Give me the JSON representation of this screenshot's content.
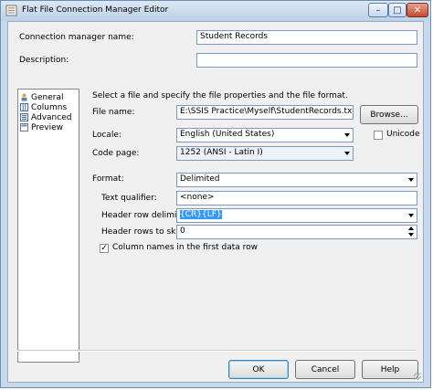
{
  "window": {
    "title": "Flat File Connection Manager Editor"
  },
  "fields": {
    "connection_name_label": "Connection manager name:",
    "connection_name_value": "Student Records",
    "description_label": "Description:",
    "description_value": ""
  },
  "nav": {
    "items": [
      {
        "label": "General",
        "selected": true
      },
      {
        "label": "Columns"
      },
      {
        "label": "Advanced"
      },
      {
        "label": "Preview"
      }
    ]
  },
  "general": {
    "instruction": "Select a file and specify the file properties and the file format.",
    "file_name_label": "File name:",
    "file_name_value": "E:\\SSIS Practice\\Myself\\StudentRecords.txt",
    "browse_label": "Browse...",
    "locale_label": "Locale:",
    "locale_value": "English (United States)",
    "unicode_label": "Unicode",
    "unicode_checked": false,
    "code_page_label": "Code page:",
    "code_page_value": "1252  (ANSI - Latin I)",
    "format_label": "Format:",
    "format_value": "Delimited",
    "text_qualifier_label": "Text qualifier:",
    "text_qualifier_value": "<none>",
    "header_row_delimiter_label": "Header row delimiter:",
    "header_row_delimiter_value": "{CR}{LF}",
    "header_rows_skip_label": "Header rows to skip:",
    "header_rows_skip_value": "0",
    "column_names_label": "Column names in the first data row",
    "column_names_checked": true
  },
  "buttons": {
    "ok": "OK",
    "cancel": "Cancel",
    "help": "Help"
  },
  "colors": {
    "selection": "#3399ff",
    "title_bar": "#c8d9ea",
    "close_button": "#c24a30"
  }
}
